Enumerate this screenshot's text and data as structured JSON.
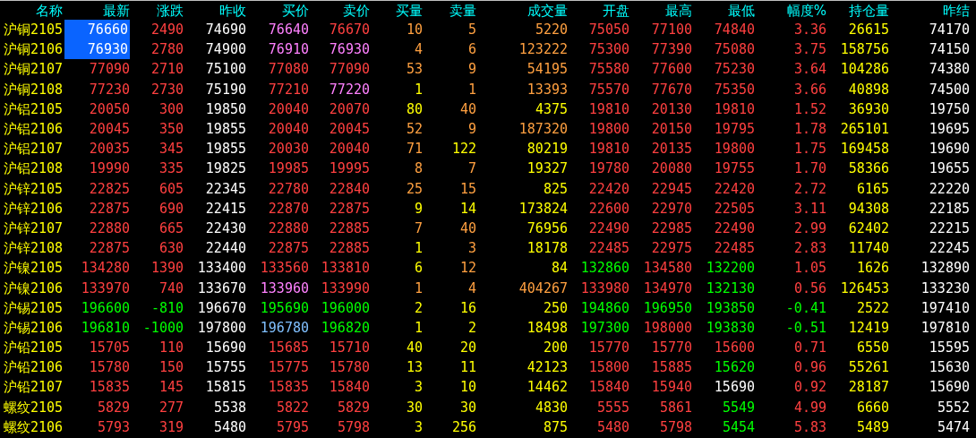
{
  "columns": [
    "名称",
    "最新",
    "涨跌",
    "昨收",
    "买价",
    "卖价",
    "买量",
    "卖量",
    "成交量",
    "开盘",
    "最高",
    "最低",
    "幅度%",
    "持仓量",
    "昨结"
  ],
  "rows": [
    {
      "name": "沪铜2105",
      "selected": true,
      "cells": [
        {
          "text": "76660",
          "color": "#ffffff"
        },
        {
          "text": "2490",
          "color": "#ff4040"
        },
        {
          "text": "74690",
          "color": "#ffffff"
        },
        {
          "text": "76640",
          "color": "#ff80ff"
        },
        {
          "text": "76670",
          "color": "#ff4040"
        },
        {
          "text": "10",
          "color": "#ffa040"
        },
        {
          "text": "5",
          "color": "#ffa040"
        },
        {
          "text": "5220",
          "color": "#ffa040"
        },
        {
          "text": "75050",
          "color": "#ff4040"
        },
        {
          "text": "77100",
          "color": "#ff4040"
        },
        {
          "text": "74840",
          "color": "#ff4040"
        },
        {
          "text": "3.36",
          "color": "#ff4040"
        },
        {
          "text": "26615",
          "color": "#ffff00"
        },
        {
          "text": "74170",
          "color": "#ffffff"
        }
      ]
    },
    {
      "name": "沪铜2106",
      "selected": true,
      "cells": [
        {
          "text": "76930",
          "color": "#ffffff"
        },
        {
          "text": "2780",
          "color": "#ff4040"
        },
        {
          "text": "74900",
          "color": "#ffffff"
        },
        {
          "text": "76910",
          "color": "#ff80ff"
        },
        {
          "text": "76930",
          "color": "#ff80ff"
        },
        {
          "text": "4",
          "color": "#ffa040"
        },
        {
          "text": "6",
          "color": "#ffa040"
        },
        {
          "text": "123222",
          "color": "#ffa040"
        },
        {
          "text": "75300",
          "color": "#ff4040"
        },
        {
          "text": "77390",
          "color": "#ff4040"
        },
        {
          "text": "75080",
          "color": "#ff4040"
        },
        {
          "text": "3.75",
          "color": "#ff4040"
        },
        {
          "text": "158756",
          "color": "#ffff00"
        },
        {
          "text": "74150",
          "color": "#ffffff"
        }
      ]
    },
    {
      "name": "沪铜2107",
      "selected": false,
      "cells": [
        {
          "text": "77090",
          "color": "#ff4040"
        },
        {
          "text": "2710",
          "color": "#ff4040"
        },
        {
          "text": "75100",
          "color": "#ffffff"
        },
        {
          "text": "77080",
          "color": "#ff4040"
        },
        {
          "text": "77090",
          "color": "#ff4040"
        },
        {
          "text": "53",
          "color": "#ffa040"
        },
        {
          "text": "9",
          "color": "#ffa040"
        },
        {
          "text": "54195",
          "color": "#ffa040"
        },
        {
          "text": "75580",
          "color": "#ff4040"
        },
        {
          "text": "77600",
          "color": "#ff4040"
        },
        {
          "text": "75230",
          "color": "#ff4040"
        },
        {
          "text": "3.64",
          "color": "#ff4040"
        },
        {
          "text": "104286",
          "color": "#ffff00"
        },
        {
          "text": "74380",
          "color": "#ffffff"
        }
      ]
    },
    {
      "name": "沪铜2108",
      "selected": false,
      "cells": [
        {
          "text": "77230",
          "color": "#ff4040"
        },
        {
          "text": "2730",
          "color": "#ff4040"
        },
        {
          "text": "75190",
          "color": "#ffffff"
        },
        {
          "text": "77210",
          "color": "#ff4040"
        },
        {
          "text": "77220",
          "color": "#ff80ff"
        },
        {
          "text": "1",
          "color": "#ffff00"
        },
        {
          "text": "1",
          "color": "#ffa040"
        },
        {
          "text": "13393",
          "color": "#ffa040"
        },
        {
          "text": "75570",
          "color": "#ff4040"
        },
        {
          "text": "77670",
          "color": "#ff4040"
        },
        {
          "text": "75350",
          "color": "#ff4040"
        },
        {
          "text": "3.66",
          "color": "#ff4040"
        },
        {
          "text": "40898",
          "color": "#ffff00"
        },
        {
          "text": "74500",
          "color": "#ffffff"
        }
      ]
    },
    {
      "name": "沪铝2105",
      "selected": false,
      "cells": [
        {
          "text": "20050",
          "color": "#ff4040"
        },
        {
          "text": "300",
          "color": "#ff4040"
        },
        {
          "text": "19850",
          "color": "#ffffff"
        },
        {
          "text": "20040",
          "color": "#ff4040"
        },
        {
          "text": "20070",
          "color": "#ff4040"
        },
        {
          "text": "80",
          "color": "#ffff00"
        },
        {
          "text": "40",
          "color": "#ffa040"
        },
        {
          "text": "4375",
          "color": "#ffff00"
        },
        {
          "text": "19810",
          "color": "#ff4040"
        },
        {
          "text": "20130",
          "color": "#ff4040"
        },
        {
          "text": "19810",
          "color": "#ff4040"
        },
        {
          "text": "1.52",
          "color": "#ff4040"
        },
        {
          "text": "36930",
          "color": "#ffff00"
        },
        {
          "text": "19750",
          "color": "#ffffff"
        }
      ]
    },
    {
      "name": "沪铝2106",
      "selected": false,
      "cells": [
        {
          "text": "20045",
          "color": "#ff4040"
        },
        {
          "text": "350",
          "color": "#ff4040"
        },
        {
          "text": "19855",
          "color": "#ffffff"
        },
        {
          "text": "20040",
          "color": "#ff4040"
        },
        {
          "text": "20045",
          "color": "#ff4040"
        },
        {
          "text": "52",
          "color": "#ffa040"
        },
        {
          "text": "9",
          "color": "#ffa040"
        },
        {
          "text": "187320",
          "color": "#ffa040"
        },
        {
          "text": "19800",
          "color": "#ff4040"
        },
        {
          "text": "20150",
          "color": "#ff4040"
        },
        {
          "text": "19795",
          "color": "#ff4040"
        },
        {
          "text": "1.78",
          "color": "#ff4040"
        },
        {
          "text": "265101",
          "color": "#ffff00"
        },
        {
          "text": "19695",
          "color": "#ffffff"
        }
      ]
    },
    {
      "name": "沪铝2107",
      "selected": false,
      "cells": [
        {
          "text": "20035",
          "color": "#ff4040"
        },
        {
          "text": "345",
          "color": "#ff4040"
        },
        {
          "text": "19855",
          "color": "#ffffff"
        },
        {
          "text": "20030",
          "color": "#ff4040"
        },
        {
          "text": "20040",
          "color": "#ff4040"
        },
        {
          "text": "71",
          "color": "#ffa040"
        },
        {
          "text": "122",
          "color": "#ffff00"
        },
        {
          "text": "80219",
          "color": "#ffff00"
        },
        {
          "text": "19810",
          "color": "#ff4040"
        },
        {
          "text": "20135",
          "color": "#ff4040"
        },
        {
          "text": "19800",
          "color": "#ff4040"
        },
        {
          "text": "1.75",
          "color": "#ff4040"
        },
        {
          "text": "169458",
          "color": "#ffff00"
        },
        {
          "text": "19690",
          "color": "#ffffff"
        }
      ]
    },
    {
      "name": "沪铝2108",
      "selected": false,
      "cells": [
        {
          "text": "19990",
          "color": "#ff4040"
        },
        {
          "text": "335",
          "color": "#ff4040"
        },
        {
          "text": "19825",
          "color": "#ffffff"
        },
        {
          "text": "19985",
          "color": "#ff4040"
        },
        {
          "text": "19995",
          "color": "#ff4040"
        },
        {
          "text": "8",
          "color": "#ffa040"
        },
        {
          "text": "7",
          "color": "#ffa040"
        },
        {
          "text": "19327",
          "color": "#ffff00"
        },
        {
          "text": "19780",
          "color": "#ff4040"
        },
        {
          "text": "20080",
          "color": "#ff4040"
        },
        {
          "text": "19755",
          "color": "#ff4040"
        },
        {
          "text": "1.70",
          "color": "#ff4040"
        },
        {
          "text": "58366",
          "color": "#ffff00"
        },
        {
          "text": "19655",
          "color": "#ffffff"
        }
      ]
    },
    {
      "name": "沪锌2105",
      "selected": false,
      "cells": [
        {
          "text": "22825",
          "color": "#ff4040"
        },
        {
          "text": "605",
          "color": "#ff4040"
        },
        {
          "text": "22345",
          "color": "#ffffff"
        },
        {
          "text": "22780",
          "color": "#ff4040"
        },
        {
          "text": "22840",
          "color": "#ff4040"
        },
        {
          "text": "25",
          "color": "#ffa040"
        },
        {
          "text": "15",
          "color": "#ffa040"
        },
        {
          "text": "825",
          "color": "#ffff00"
        },
        {
          "text": "22420",
          "color": "#ff4040"
        },
        {
          "text": "22945",
          "color": "#ff4040"
        },
        {
          "text": "22420",
          "color": "#ff4040"
        },
        {
          "text": "2.72",
          "color": "#ff4040"
        },
        {
          "text": "6165",
          "color": "#ffff00"
        },
        {
          "text": "22220",
          "color": "#ffffff"
        }
      ]
    },
    {
      "name": "沪锌2106",
      "selected": false,
      "cells": [
        {
          "text": "22875",
          "color": "#ff4040"
        },
        {
          "text": "690",
          "color": "#ff4040"
        },
        {
          "text": "22415",
          "color": "#ffffff"
        },
        {
          "text": "22870",
          "color": "#ff4040"
        },
        {
          "text": "22875",
          "color": "#ff4040"
        },
        {
          "text": "9",
          "color": "#ffff00"
        },
        {
          "text": "14",
          "color": "#ffff00"
        },
        {
          "text": "173824",
          "color": "#ffff00"
        },
        {
          "text": "22600",
          "color": "#ff4040"
        },
        {
          "text": "22970",
          "color": "#ff4040"
        },
        {
          "text": "22505",
          "color": "#ff4040"
        },
        {
          "text": "3.11",
          "color": "#ff4040"
        },
        {
          "text": "94308",
          "color": "#ffff00"
        },
        {
          "text": "22185",
          "color": "#ffffff"
        }
      ]
    },
    {
      "name": "沪锌2107",
      "selected": false,
      "cells": [
        {
          "text": "22880",
          "color": "#ff4040"
        },
        {
          "text": "665",
          "color": "#ff4040"
        },
        {
          "text": "22430",
          "color": "#ffffff"
        },
        {
          "text": "22880",
          "color": "#ff4040"
        },
        {
          "text": "22885",
          "color": "#ff4040"
        },
        {
          "text": "7",
          "color": "#ffa040"
        },
        {
          "text": "40",
          "color": "#ffa040"
        },
        {
          "text": "76956",
          "color": "#ffff00"
        },
        {
          "text": "22490",
          "color": "#ff4040"
        },
        {
          "text": "22985",
          "color": "#ff4040"
        },
        {
          "text": "22490",
          "color": "#ff4040"
        },
        {
          "text": "2.99",
          "color": "#ff4040"
        },
        {
          "text": "62402",
          "color": "#ffff00"
        },
        {
          "text": "22215",
          "color": "#ffffff"
        }
      ]
    },
    {
      "name": "沪锌2108",
      "selected": false,
      "cells": [
        {
          "text": "22875",
          "color": "#ff4040"
        },
        {
          "text": "630",
          "color": "#ff4040"
        },
        {
          "text": "22440",
          "color": "#ffffff"
        },
        {
          "text": "22875",
          "color": "#ff4040"
        },
        {
          "text": "22885",
          "color": "#ff4040"
        },
        {
          "text": "1",
          "color": "#ffff00"
        },
        {
          "text": "3",
          "color": "#ffa040"
        },
        {
          "text": "18178",
          "color": "#ffff00"
        },
        {
          "text": "22485",
          "color": "#ff4040"
        },
        {
          "text": "22975",
          "color": "#ff4040"
        },
        {
          "text": "22485",
          "color": "#ff4040"
        },
        {
          "text": "2.83",
          "color": "#ff4040"
        },
        {
          "text": "11740",
          "color": "#ffff00"
        },
        {
          "text": "22245",
          "color": "#ffffff"
        }
      ]
    },
    {
      "name": "沪镍2105",
      "selected": false,
      "cells": [
        {
          "text": "134280",
          "color": "#ff4040"
        },
        {
          "text": "1390",
          "color": "#ff4040"
        },
        {
          "text": "133400",
          "color": "#ffffff"
        },
        {
          "text": "133560",
          "color": "#ff4040"
        },
        {
          "text": "133810",
          "color": "#ff4040"
        },
        {
          "text": "6",
          "color": "#ffff00"
        },
        {
          "text": "12",
          "color": "#ffa040"
        },
        {
          "text": "84",
          "color": "#ffff00"
        },
        {
          "text": "132860",
          "color": "#00ff00"
        },
        {
          "text": "134580",
          "color": "#ff4040"
        },
        {
          "text": "132200",
          "color": "#00ff00"
        },
        {
          "text": "1.05",
          "color": "#ff4040"
        },
        {
          "text": "1626",
          "color": "#ffff00"
        },
        {
          "text": "132890",
          "color": "#ffffff"
        }
      ]
    },
    {
      "name": "沪镍2106",
      "selected": false,
      "cells": [
        {
          "text": "133970",
          "color": "#ff4040"
        },
        {
          "text": "740",
          "color": "#ff4040"
        },
        {
          "text": "133670",
          "color": "#ffffff"
        },
        {
          "text": "133960",
          "color": "#ff80ff"
        },
        {
          "text": "133990",
          "color": "#ff4040"
        },
        {
          "text": "1",
          "color": "#ffa040"
        },
        {
          "text": "4",
          "color": "#ffa040"
        },
        {
          "text": "404267",
          "color": "#ffa040"
        },
        {
          "text": "133980",
          "color": "#ff4040"
        },
        {
          "text": "134970",
          "color": "#ff4040"
        },
        {
          "text": "132130",
          "color": "#00ff00"
        },
        {
          "text": "0.56",
          "color": "#ff4040"
        },
        {
          "text": "126453",
          "color": "#ffff00"
        },
        {
          "text": "133230",
          "color": "#ffffff"
        }
      ]
    },
    {
      "name": "沪锡2105",
      "selected": false,
      "cells": [
        {
          "text": "196600",
          "color": "#00ff00"
        },
        {
          "text": "-810",
          "color": "#00ff00"
        },
        {
          "text": "196670",
          "color": "#ffffff"
        },
        {
          "text": "195690",
          "color": "#00ff00"
        },
        {
          "text": "196000",
          "color": "#00ff00"
        },
        {
          "text": "2",
          "color": "#ffff00"
        },
        {
          "text": "16",
          "color": "#ffff00"
        },
        {
          "text": "250",
          "color": "#ffff00"
        },
        {
          "text": "194860",
          "color": "#00ff00"
        },
        {
          "text": "196950",
          "color": "#00ff00"
        },
        {
          "text": "193850",
          "color": "#00ff00"
        },
        {
          "text": "-0.41",
          "color": "#00ff00"
        },
        {
          "text": "2522",
          "color": "#ffff00"
        },
        {
          "text": "197410",
          "color": "#ffffff"
        }
      ]
    },
    {
      "name": "沪锡2106",
      "selected": false,
      "cells": [
        {
          "text": "196810",
          "color": "#00ff00"
        },
        {
          "text": "-1000",
          "color": "#00ff00"
        },
        {
          "text": "197800",
          "color": "#ffffff"
        },
        {
          "text": "196780",
          "color": "#80c0ff"
        },
        {
          "text": "196820",
          "color": "#00ff00"
        },
        {
          "text": "1",
          "color": "#ffff00"
        },
        {
          "text": "2",
          "color": "#ffff00"
        },
        {
          "text": "18498",
          "color": "#ffff00"
        },
        {
          "text": "197300",
          "color": "#00ff00"
        },
        {
          "text": "198000",
          "color": "#ff4040"
        },
        {
          "text": "193830",
          "color": "#00ff00"
        },
        {
          "text": "-0.51",
          "color": "#00ff00"
        },
        {
          "text": "12419",
          "color": "#ffff00"
        },
        {
          "text": "197810",
          "color": "#ffffff"
        }
      ]
    },
    {
      "name": "沪铅2105",
      "selected": false,
      "cells": [
        {
          "text": "15705",
          "color": "#ff4040"
        },
        {
          "text": "110",
          "color": "#ff4040"
        },
        {
          "text": "15690",
          "color": "#ffffff"
        },
        {
          "text": "15685",
          "color": "#ff4040"
        },
        {
          "text": "15710",
          "color": "#ff4040"
        },
        {
          "text": "40",
          "color": "#ffff00"
        },
        {
          "text": "20",
          "color": "#ffff00"
        },
        {
          "text": "200",
          "color": "#ffff00"
        },
        {
          "text": "15770",
          "color": "#ff4040"
        },
        {
          "text": "15770",
          "color": "#ff4040"
        },
        {
          "text": "15600",
          "color": "#ff4040"
        },
        {
          "text": "0.71",
          "color": "#ff4040"
        },
        {
          "text": "6550",
          "color": "#ffff00"
        },
        {
          "text": "15595",
          "color": "#ffffff"
        }
      ]
    },
    {
      "name": "沪铅2106",
      "selected": false,
      "cells": [
        {
          "text": "15780",
          "color": "#ff4040"
        },
        {
          "text": "150",
          "color": "#ff4040"
        },
        {
          "text": "15755",
          "color": "#ffffff"
        },
        {
          "text": "15775",
          "color": "#ff4040"
        },
        {
          "text": "15780",
          "color": "#ff4040"
        },
        {
          "text": "13",
          "color": "#ffff00"
        },
        {
          "text": "11",
          "color": "#ffff00"
        },
        {
          "text": "42123",
          "color": "#ffff00"
        },
        {
          "text": "15800",
          "color": "#ff4040"
        },
        {
          "text": "15885",
          "color": "#ff4040"
        },
        {
          "text": "15620",
          "color": "#00ff00"
        },
        {
          "text": "0.96",
          "color": "#ff4040"
        },
        {
          "text": "55261",
          "color": "#ffff00"
        },
        {
          "text": "15630",
          "color": "#ffffff"
        }
      ]
    },
    {
      "name": "沪铅2107",
      "selected": false,
      "cells": [
        {
          "text": "15835",
          "color": "#ff4040"
        },
        {
          "text": "145",
          "color": "#ff4040"
        },
        {
          "text": "15815",
          "color": "#ffffff"
        },
        {
          "text": "15835",
          "color": "#ff4040"
        },
        {
          "text": "15840",
          "color": "#ff4040"
        },
        {
          "text": "3",
          "color": "#ffff00"
        },
        {
          "text": "10",
          "color": "#ffff00"
        },
        {
          "text": "14462",
          "color": "#ffff00"
        },
        {
          "text": "15840",
          "color": "#ff4040"
        },
        {
          "text": "15940",
          "color": "#ff4040"
        },
        {
          "text": "15690",
          "color": "#ffffff"
        },
        {
          "text": "0.92",
          "color": "#ff4040"
        },
        {
          "text": "28187",
          "color": "#ffff00"
        },
        {
          "text": "15690",
          "color": "#ffffff"
        }
      ]
    },
    {
      "name": "螺纹2105",
      "selected": false,
      "cells": [
        {
          "text": "5829",
          "color": "#ff4040"
        },
        {
          "text": "277",
          "color": "#ff4040"
        },
        {
          "text": "5538",
          "color": "#ffffff"
        },
        {
          "text": "5822",
          "color": "#ff4040"
        },
        {
          "text": "5829",
          "color": "#ff4040"
        },
        {
          "text": "30",
          "color": "#ffff00"
        },
        {
          "text": "30",
          "color": "#ffff00"
        },
        {
          "text": "4830",
          "color": "#ffff00"
        },
        {
          "text": "5555",
          "color": "#ff4040"
        },
        {
          "text": "5861",
          "color": "#ff4040"
        },
        {
          "text": "5549",
          "color": "#00ff00"
        },
        {
          "text": "4.99",
          "color": "#ff4040"
        },
        {
          "text": "6660",
          "color": "#ffff00"
        },
        {
          "text": "5552",
          "color": "#ffffff"
        }
      ]
    },
    {
      "name": "螺纹2106",
      "selected": false,
      "cells": [
        {
          "text": "5793",
          "color": "#ff4040"
        },
        {
          "text": "319",
          "color": "#ff4040"
        },
        {
          "text": "5480",
          "color": "#ffffff"
        },
        {
          "text": "5795",
          "color": "#ff4040"
        },
        {
          "text": "5798",
          "color": "#ff4040"
        },
        {
          "text": "3",
          "color": "#ffff00"
        },
        {
          "text": "256",
          "color": "#ffff00"
        },
        {
          "text": "875",
          "color": "#ffff00"
        },
        {
          "text": "5480",
          "color": "#ff4040"
        },
        {
          "text": "5798",
          "color": "#ff4040"
        },
        {
          "text": "5454",
          "color": "#00ff00"
        },
        {
          "text": "5.83",
          "color": "#ff4040"
        },
        {
          "text": "5489",
          "color": "#ffff00"
        },
        {
          "text": "5474",
          "color": "#ffffff"
        }
      ]
    }
  ]
}
